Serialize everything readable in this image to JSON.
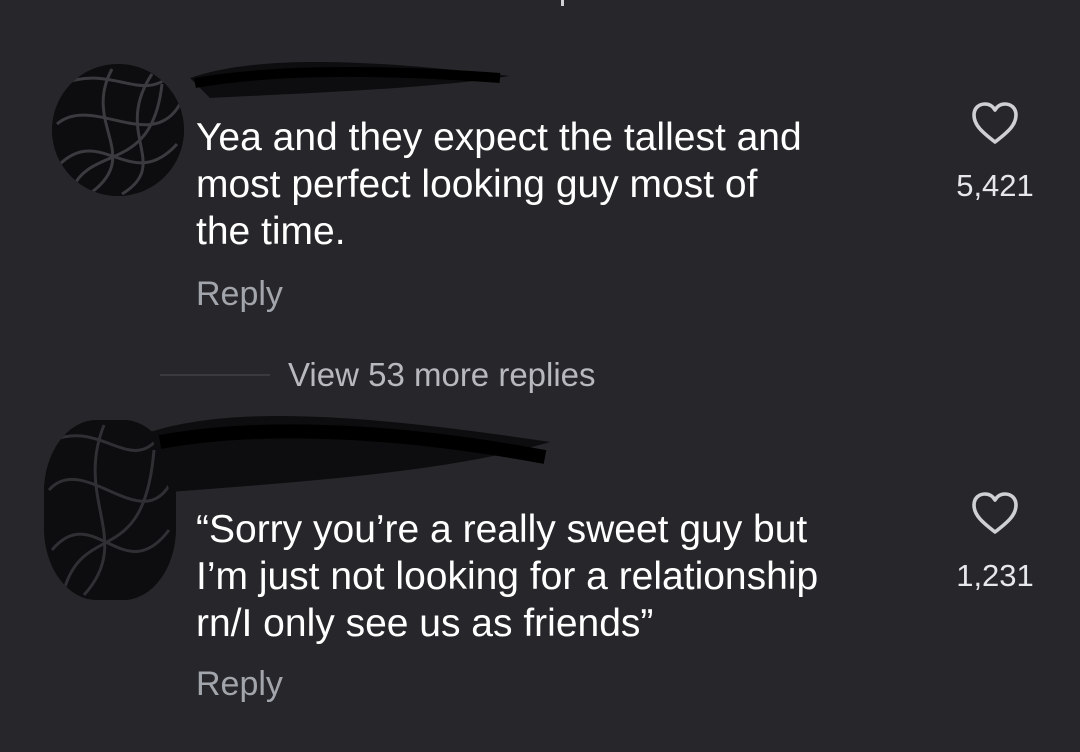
{
  "comments": [
    {
      "text_lines": [
        "Yea and they expect the tallest and",
        "most perfect looking guy most of",
        "the time."
      ],
      "reply_label": "Reply",
      "like_count": "5,421",
      "like_icon": "heart-outline-icon"
    },
    {
      "text_lines": [
        "“Sorry you’re a really sweet guy but",
        "I’m just not looking for a relationship",
        "rn/I only see us as friends”"
      ],
      "reply_label": "Reply",
      "like_count": "1,231",
      "like_icon": "heart-outline-icon"
    }
  ],
  "view_more": {
    "label": "View 53 more replies"
  },
  "colors": {
    "background": "#27272b",
    "text": "#ffffff",
    "muted": "#a3a5ac"
  }
}
